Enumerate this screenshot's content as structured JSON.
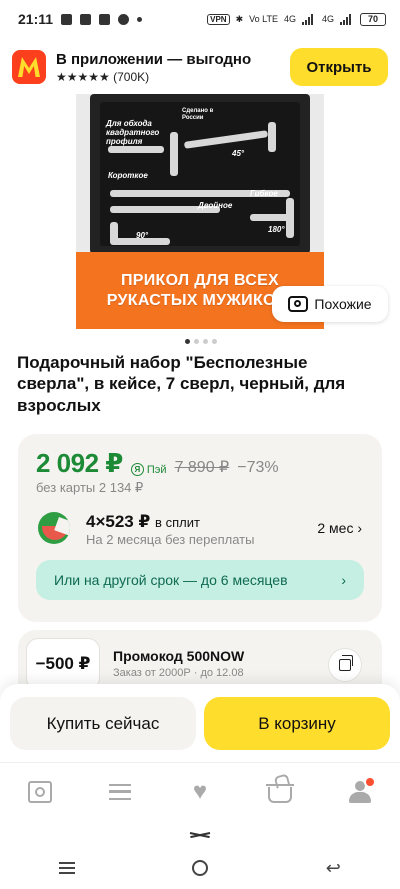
{
  "status_bar": {
    "time": "21:11",
    "vpn": "VPN",
    "net1": "Vo LTE",
    "net2": "4G",
    "net3": "4G",
    "battery": "70"
  },
  "app_banner": {
    "title": "В приложении — выгодно",
    "rating": "★★★★★ (700K)",
    "open_label": "Открыть"
  },
  "product_image": {
    "label_top": "Для обхода квадратного профиля",
    "label_made": "Сделано в России",
    "label_short": "Короткое",
    "label_double": "Двойное",
    "label_flex": "Гибкое",
    "label_45": "45°",
    "label_90": "90°",
    "label_180": "180°",
    "band_line1": "ПРИКОЛ ДЛЯ ВСЕХ",
    "band_line2": "РУКАСТЫХ МУЖИКОВ!"
  },
  "similar_label": "Похожие",
  "gallery": {
    "total": 4,
    "active": 0
  },
  "product_title": "Подарочный набор \"Бесполезные сверла\", в кейсе, 7 сверл, черный, для взрослых",
  "price": {
    "current": "2 092 ₽",
    "pay_label": "Пэй",
    "old": "7 890 ₽",
    "discount": "−73%",
    "no_card": "без карты 2 134 ₽",
    "split_amount": "4×523 ₽",
    "split_suffix": "в сплит",
    "split_sub": "На 2 месяца без переплаты",
    "split_months": "2 мес ›",
    "other_term": "Или на другой срок — до 6 месяцев",
    "other_term_chevron": "›"
  },
  "promo": {
    "coupon": "−500 ₽",
    "title": "Промокод 500NOW",
    "subtitle": "Заказ от 2000Р · до 12.08"
  },
  "actions": {
    "buy_now": "Купить сейчас",
    "add_to_cart": "В корзину"
  }
}
